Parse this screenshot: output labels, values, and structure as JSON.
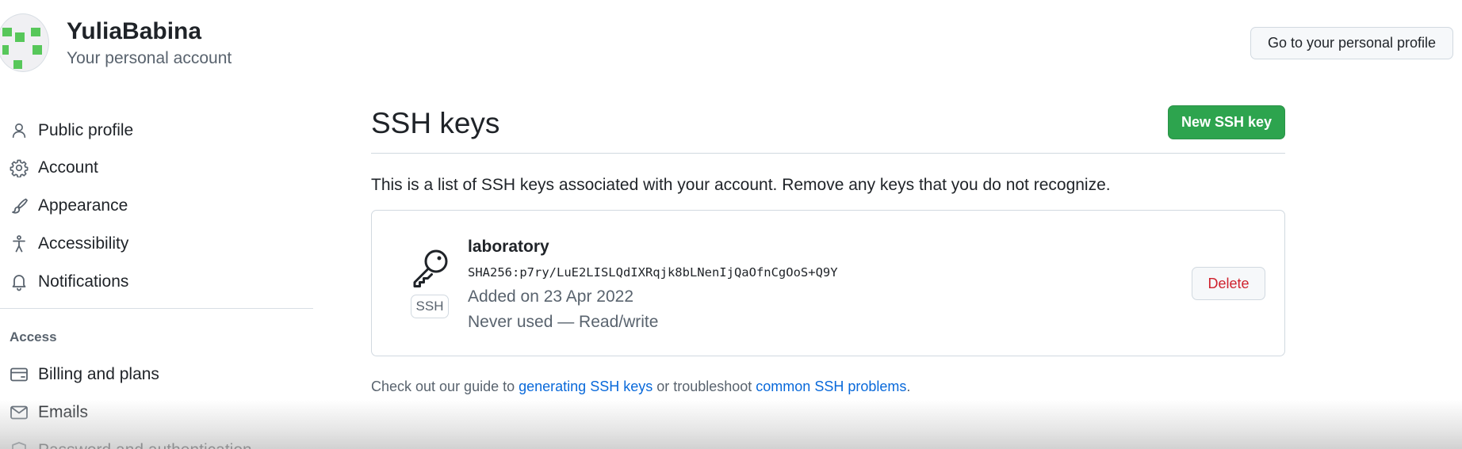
{
  "header": {
    "user_name": "YuliaBabina",
    "account_type": "Your personal account",
    "profile_button": "Go to your personal profile"
  },
  "sidebar": {
    "items": [
      {
        "label": "Public profile",
        "icon": "person-icon"
      },
      {
        "label": "Account",
        "icon": "gear-icon"
      },
      {
        "label": "Appearance",
        "icon": "paintbrush-icon"
      },
      {
        "label": "Accessibility",
        "icon": "accessibility-icon"
      },
      {
        "label": "Notifications",
        "icon": "bell-icon"
      }
    ],
    "access_heading": "Access",
    "access_items": [
      {
        "label": "Billing and plans",
        "icon": "credit-card-icon"
      },
      {
        "label": "Emails",
        "icon": "mail-icon"
      },
      {
        "label": "Password and authentication",
        "icon": "shield-lock-icon"
      }
    ]
  },
  "main": {
    "title": "SSH keys",
    "new_key_button": "New SSH key",
    "intro": "This is a list of SSH keys associated with your account. Remove any keys that you do not recognize.",
    "keys": [
      {
        "title": "laboratory",
        "fingerprint": "SHA256:p7ry/LuE2LISLQdIXRqjk8bLNenIjQaOfnCgOoS+Q9Y",
        "added": "Added on 23 Apr 2022",
        "usage": "Never used — Read/write",
        "badge": "SSH",
        "delete_label": "Delete"
      }
    ],
    "footer": {
      "prefix": "Check out our guide to ",
      "link1": "generating SSH keys",
      "middle": " or troubleshoot ",
      "link2": "common SSH problems",
      "suffix": "."
    }
  },
  "colors": {
    "primary_button": "#2da44e",
    "danger_text": "#cf222e",
    "link": "#0969da",
    "avatar_identicon": "#57c75a"
  }
}
